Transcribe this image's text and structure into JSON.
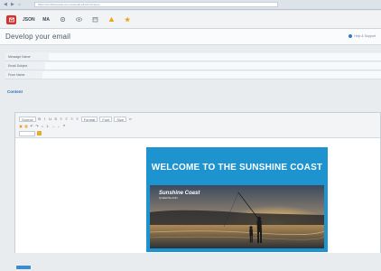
{
  "browser": {
    "url": "https://sunshinecoast.com.au/email-editor/compose"
  },
  "app_toolbar": {
    "buttons": [
      "",
      "JSON",
      "MA",
      "",
      "",
      "",
      "",
      ""
    ]
  },
  "header": {
    "title": "Develop your email",
    "help": "Help & Support"
  },
  "form": {
    "rows": [
      {
        "label": "Message Name"
      },
      {
        "label": "Email Subject"
      },
      {
        "label": "From Name"
      }
    ]
  },
  "content_link": "Content",
  "editor": {
    "font_select": "Font",
    "size_select": "Size",
    "format_select": "Format",
    "source_label": "Source"
  },
  "email": {
    "headline": "WELCOME TO THE SUNSHINE COAST",
    "logo_main": "Sunshine Coast",
    "logo_sub": "QUEENSLAND"
  }
}
